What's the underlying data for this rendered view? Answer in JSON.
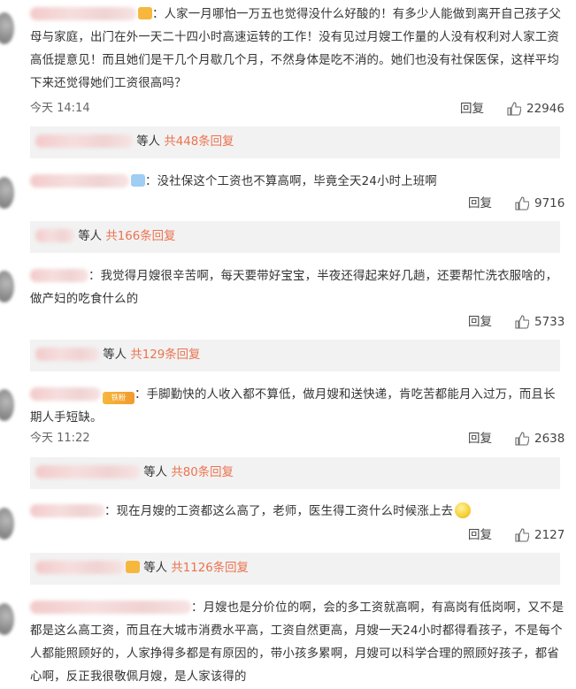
{
  "comments": [
    {
      "text": "：人家一月哪怕一万五也觉得没什么好酸的！有多少人能做到离开自己孩子父母与家庭，出门在外一天二十四小时高速运转的工作！没有见过月嫂工作量的人没有权利对人家工资高低提意见！而且她们是干几个月歇几个月，不然身体是吃不消的。她们也没有社保医保，这样平均下来还觉得她们工资很高吗？",
      "time": "今天 14:14",
      "reply_label": "回复",
      "likes": "22946",
      "sub": {
        "prefix": "等人",
        "total": "共448条回复"
      }
    },
    {
      "text": "：没社保这个工资也不算高啊，毕竟全天24小时上班啊",
      "time": "",
      "reply_label": "回复",
      "likes": "9716",
      "sub": {
        "prefix": "等人",
        "total": "共166条回复"
      }
    },
    {
      "text": "：我觉得月嫂很辛苦啊，每天要带好宝宝，半夜还得起来好几趟，还要帮忙洗衣服啥的，做产妇的吃食什么的",
      "time": "",
      "reply_label": "回复",
      "likes": "5733",
      "sub": {
        "prefix": "等人",
        "total": "共129条回复"
      }
    },
    {
      "text": "：手脚勤快的人收入都不算低，做月嫂和送快递，肯吃苦都能月入过万，而且长期人手短缺。",
      "time": "今天 11:22",
      "reply_label": "回复",
      "likes": "2638",
      "badge_text": "铁粉",
      "sub": {
        "prefix": "等人",
        "total": "共80条回复"
      }
    },
    {
      "text": "：现在月嫂的工资都这么高了，老师，医生得工资什么时候涨上去",
      "time": "",
      "reply_label": "回复",
      "likes": "2127",
      "sub": {
        "prefix": "等人",
        "total": "共1126条回复"
      }
    },
    {
      "text": "：月嫂也是分价位的啊，会的多工资就高啊，有高岗有低岗啊，又不是都是这么高工资，而且在大城市消费水平高，工资自然更高，月嫂一天24小时都得看孩子，不是每个人都能照顾好的，人家挣得多都是有原因的，带小孩多累啊，月嫂可以科学合理的照顾好孩子，都省心啊，反正我很敬佩月嫂，是人家该得的"
    }
  ],
  "colors": {
    "link": "#eb7350",
    "sub_bg": "#f2f2f2",
    "text": "#333333"
  }
}
